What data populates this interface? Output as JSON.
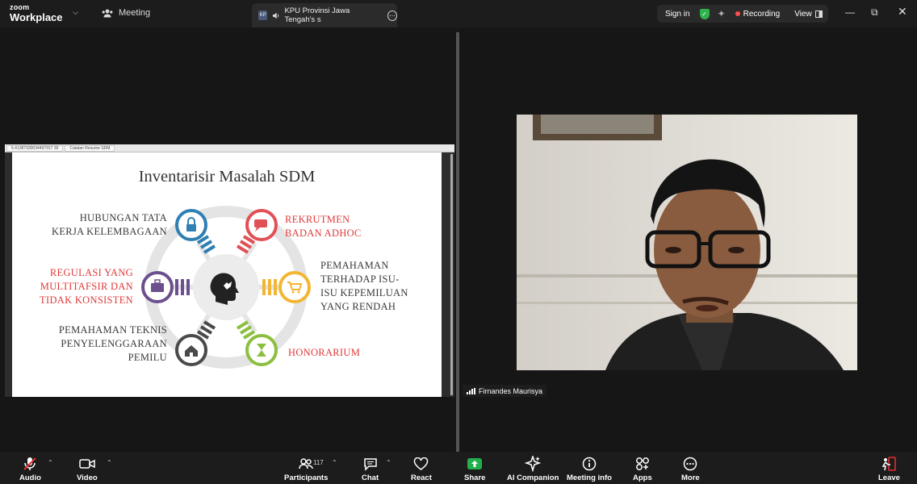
{
  "app": {
    "brand_top": "zoom",
    "brand_bottom": "Workplace"
  },
  "nav": {
    "meeting": "Meeting"
  },
  "tab": {
    "initials": "KP",
    "title": "KPU Provinsi Jawa Tengah's s"
  },
  "header": {
    "sign_in": "Sign in",
    "recording": "Recording",
    "view": "View"
  },
  "share": {
    "browser_tabs": [
      "5.41387930034497917 30",
      "Catatan Resume SDM"
    ],
    "slide_title": "Inventarisir Masalah SDM",
    "labels": {
      "hubungan": [
        "HUBUNGAN TATA",
        "KERJA KELEMBAGAAN"
      ],
      "rekrutmen": [
        "REKRUTMEN",
        "BADAN ADHOC"
      ],
      "regulasi": [
        "REGULASI YANG",
        "MULTITAFSIR DAN",
        "TIDAK KONSISTEN"
      ],
      "pemahaman_isu": [
        "PEMAHAMAN",
        "TERHADAP ISU-",
        "ISU KEPEMILUAN",
        "YANG RENDAH"
      ],
      "pemahaman_teknis": [
        "PEMAHAMAN TEKNIS",
        "PENYELENGGARAAN",
        "PEMILU"
      ],
      "honorarium": [
        "HONORARIUM"
      ]
    },
    "colors": {
      "blue": "#2f7fb3",
      "red": "#e05055",
      "yellow": "#f2b632",
      "green": "#8cbf3f",
      "dark": "#4a4a4a",
      "purple": "#6c4f8e"
    }
  },
  "participant": {
    "name": "Firnandes Maurisya"
  },
  "toolbar": {
    "audio": "Audio",
    "video": "Video",
    "participants": "Participants",
    "participants_count": "117",
    "chat": "Chat",
    "react": "React",
    "share": "Share",
    "ai_companion": "AI Companion",
    "meeting_info": "Meeting info",
    "apps": "Apps",
    "more": "More",
    "leave": "Leave"
  }
}
